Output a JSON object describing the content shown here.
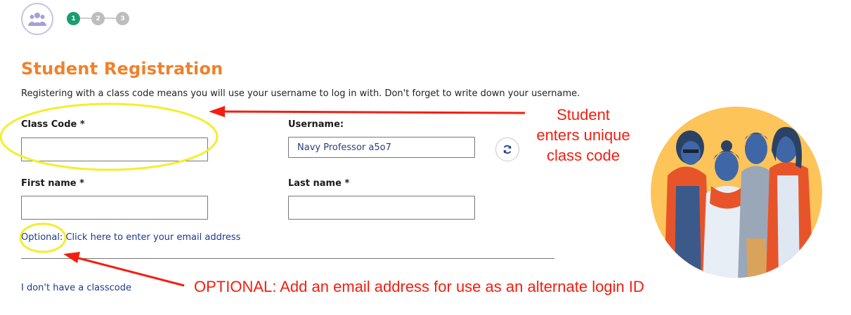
{
  "steps": [
    {
      "number": "1",
      "state": "active",
      "color": "#1a9e6e"
    },
    {
      "number": "2",
      "state": "inactive",
      "color": "#bdbdbd"
    },
    {
      "number": "3",
      "state": "inactive",
      "color": "#bdbdbd"
    }
  ],
  "header": {
    "avatar_icon": "users-icon"
  },
  "page": {
    "title": "Student Registration",
    "intro": "Registering with a class code means you will use your username to log in with. Don't forget to write down your username."
  },
  "form": {
    "class_code": {
      "label": "Class Code *",
      "value": ""
    },
    "username": {
      "label": "Username:",
      "value": "Navy Professor a5o7",
      "refresh_icon": "refresh-icon"
    },
    "first_name": {
      "label": "First name *",
      "value": ""
    },
    "last_name": {
      "label": "Last name *",
      "value": ""
    },
    "optional_email_link": "Optional: Click here to enter your email address",
    "no_classcode_link": "I don't have a classcode"
  },
  "annotations": {
    "student_note_lines": [
      "Student",
      "enters unique",
      "class code"
    ],
    "optional_note": "OPTIONAL: Add an email address for use as an alternate login ID",
    "color": "#f31e0f"
  },
  "colors": {
    "title": "#f0812b",
    "link": "#1e3a8a",
    "illustration_bg": "#fdc45a",
    "highlight": "#f4ee2c"
  }
}
